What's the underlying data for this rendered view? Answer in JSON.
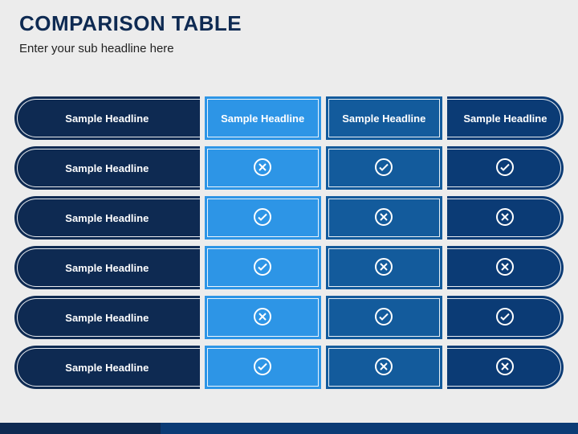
{
  "title": "COMPARISON TABLE",
  "subtitle": "Enter your sub headline here",
  "chart_data": {
    "type": "table",
    "title": "Comparison Table",
    "columns": [
      "Sample Headline",
      "Sample Headline",
      "Sample Headline",
      "Sample Headline"
    ],
    "row_labels": [
      "Sample Headline",
      "Sample Headline",
      "Sample Headline",
      "Sample Headline",
      "Sample Headline"
    ],
    "values": [
      [
        "x",
        "check",
        "check"
      ],
      [
        "check",
        "x",
        "x"
      ],
      [
        "check",
        "x",
        "x"
      ],
      [
        "x",
        "check",
        "check"
      ],
      [
        "check",
        "x",
        "x"
      ]
    ],
    "colors": {
      "navy": "#0e2a52",
      "darkblue": "#0b3b75",
      "sky": "#2d95e6",
      "blue": "#135b9c",
      "steel": "#1a5fa3"
    }
  },
  "header": {
    "c0": "Sample Headline",
    "c1": "Sample Headline",
    "c2": "Sample Headline",
    "c3": "Sample Headline"
  },
  "rows": {
    "r0": {
      "label": "Sample Headline"
    },
    "r1": {
      "label": "Sample Headline"
    },
    "r2": {
      "label": "Sample Headline"
    },
    "r3": {
      "label": "Sample Headline"
    },
    "r4": {
      "label": "Sample Headline"
    }
  }
}
